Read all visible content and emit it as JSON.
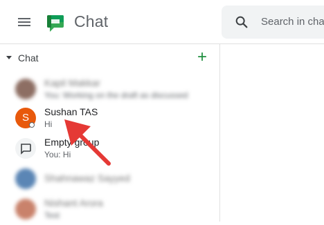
{
  "header": {
    "app_title": "Chat",
    "search_placeholder": "Search in cha",
    "menu_icon": "hamburger-menu-icon",
    "logo_icon": "google-chat-logo-icon",
    "search_icon": "search-icon"
  },
  "sidebar": {
    "section_label": "Chat",
    "add_icon": "plus-icon",
    "colors": {
      "accent": "#1e8e3e",
      "avatar_orange": "#e8590c"
    },
    "items": [
      {
        "name": "Kapil Makkar",
        "preview": "You: Working on the draft as discussed",
        "blurred": true
      },
      {
        "name": "Sushan TAS",
        "initial": "S",
        "preview": "Hi",
        "blurred": false
      },
      {
        "name": "Empty group",
        "preview": "You: Hi",
        "blurred": false
      },
      {
        "name": "Shahnawaz Sayyed",
        "preview": "",
        "blurred": true
      },
      {
        "name": "Nishant Arora",
        "preview": "Test",
        "blurred": true
      }
    ]
  }
}
